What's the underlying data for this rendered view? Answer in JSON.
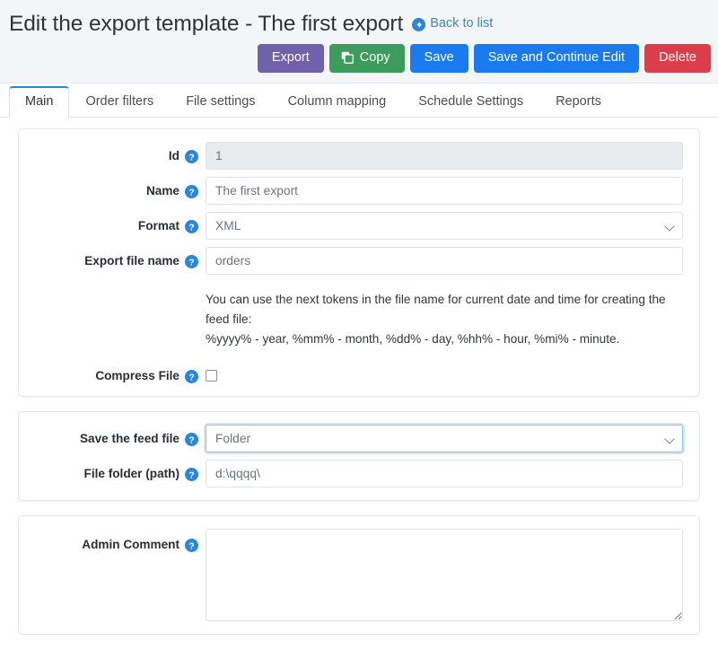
{
  "header": {
    "title": "Edit the export template - The first export",
    "back_link": "Back to list",
    "back_icon": "circle-arrow-left-icon"
  },
  "toolbar": {
    "export_label": "Export",
    "copy_label": "Copy",
    "copy_icon": "copy-icon",
    "save_label": "Save",
    "save_continue_label": "Save and Continue Edit",
    "delete_label": "Delete",
    "colors": {
      "export": "#6f61ac",
      "copy": "#3c9c5d",
      "save": "#1a7bf0",
      "save_continue": "#1a7bf0",
      "delete": "#dc3d4b"
    }
  },
  "tabs": [
    {
      "label": "Main",
      "active": true
    },
    {
      "label": "Order filters",
      "active": false
    },
    {
      "label": "File settings",
      "active": false
    },
    {
      "label": "Column mapping",
      "active": false
    },
    {
      "label": "Schedule Settings",
      "active": false
    },
    {
      "label": "Reports",
      "active": false
    }
  ],
  "help_icon": "question-mark-circle-icon",
  "form": {
    "id": {
      "label": "Id",
      "value": "1",
      "disabled": true
    },
    "name": {
      "label": "Name",
      "value": "The first export"
    },
    "format": {
      "label": "Format",
      "value": "XML",
      "options": [
        "XML"
      ]
    },
    "export_file_name": {
      "label": "Export file name",
      "value": "orders"
    },
    "tokens_hint_line1": "You can use the next tokens in the file name for current date and time for creating the feed file:",
    "tokens_hint_line2": "%yyyy% - year, %mm% - month, %dd% - day, %hh% - hour, %mi% - minute.",
    "compress_file": {
      "label": "Compress File",
      "checked": false
    },
    "save_feed_file": {
      "label": "Save the feed file",
      "value": "Folder",
      "options": [
        "Folder"
      ],
      "focused": true
    },
    "file_folder": {
      "label": "File folder (path)",
      "value": "d:\\qqqq\\"
    },
    "admin_comment": {
      "label": "Admin Comment",
      "value": ""
    }
  },
  "accent_color": "#2a86d8"
}
